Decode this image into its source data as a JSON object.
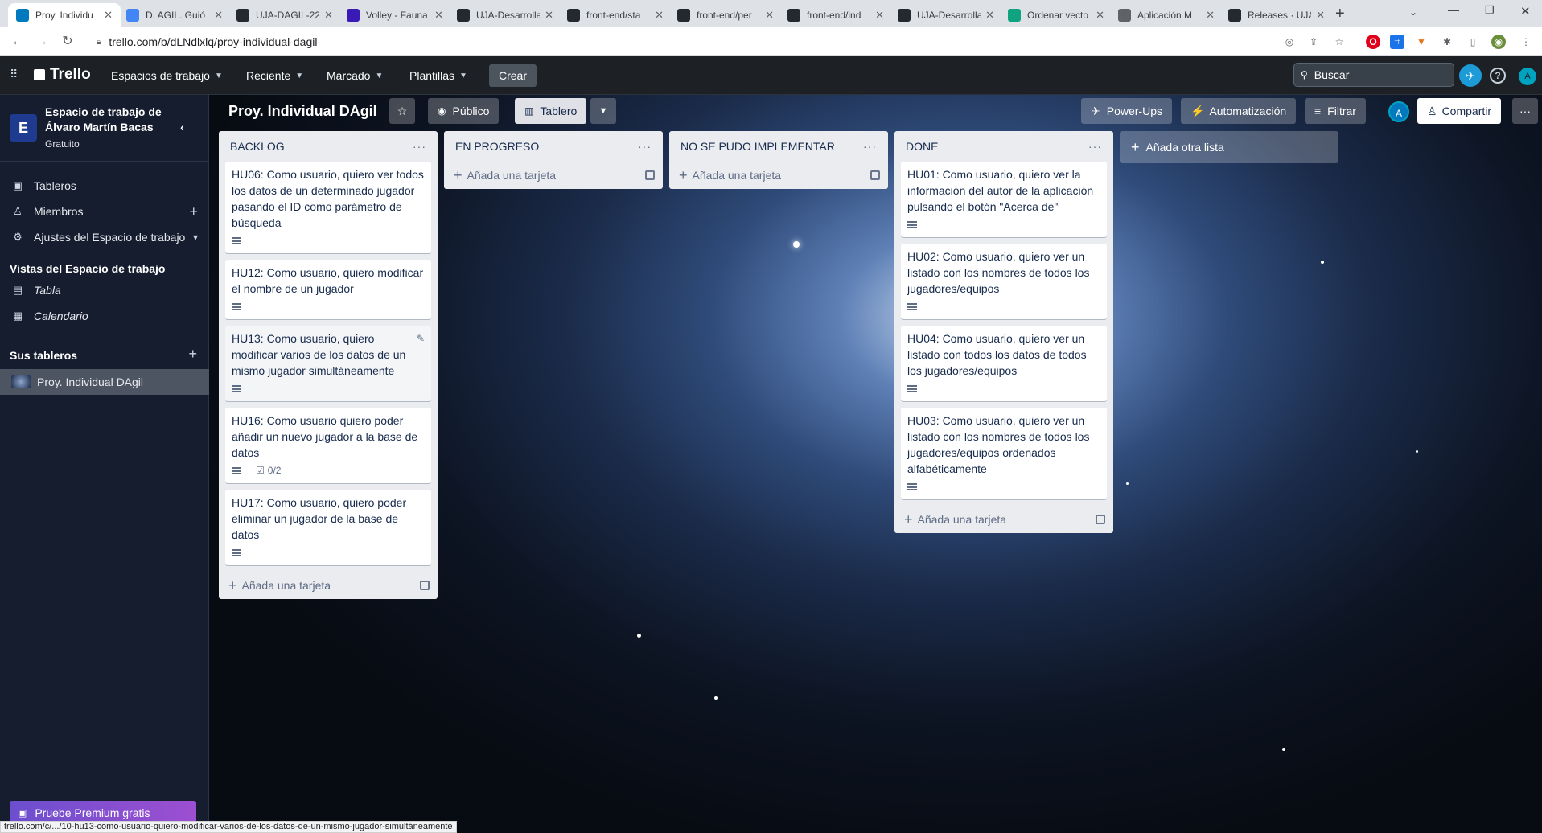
{
  "browser": {
    "tabs": [
      {
        "title": "Proy. Individu",
        "icon": "trello-icon",
        "color": "#0079bf",
        "active": true
      },
      {
        "title": "D. AGIL. Guió",
        "icon": "google-docs-icon",
        "color": "#4285f4"
      },
      {
        "title": "UJA-DAGIL-22",
        "icon": "github-icon",
        "color": "#24292f"
      },
      {
        "title": "Volley - Fauna",
        "icon": "fauna-icon",
        "color": "#3a1ab6"
      },
      {
        "title": "UJA-Desarrolla",
        "icon": "github-icon",
        "color": "#24292f"
      },
      {
        "title": "front-end/sta",
        "icon": "github-icon",
        "color": "#24292f"
      },
      {
        "title": "front-end/per",
        "icon": "github-icon",
        "color": "#24292f"
      },
      {
        "title": "front-end/ind",
        "icon": "github-icon",
        "color": "#24292f"
      },
      {
        "title": "UJA-Desarrolla",
        "icon": "github-icon",
        "color": "#24292f"
      },
      {
        "title": "Ordenar vecto",
        "icon": "chatgpt-icon",
        "color": "#10a37f"
      },
      {
        "title": "Aplicación M",
        "icon": "globe-icon",
        "color": "#5f6368"
      },
      {
        "title": "Releases · UJA",
        "icon": "github-icon",
        "color": "#24292f"
      }
    ],
    "url": "trello.com/b/dLNdlxlq/proy-individual-dagil"
  },
  "header": {
    "brand": "Trello",
    "menu": [
      "Espacios de trabajo",
      "Reciente",
      "Marcado",
      "Plantillas"
    ],
    "create": "Crear",
    "search_placeholder": "Buscar",
    "avatar": "A"
  },
  "sidebar": {
    "workspace_letter": "E",
    "workspace_name_line1": "Espacio de trabajo de",
    "workspace_name_line2": "Álvaro Martín Bacas",
    "plan": "Gratuito",
    "items": [
      "Tableros",
      "Miembros",
      "Ajustes del Espacio de trabajo"
    ],
    "views_title": "Vistas del Espacio de trabajo",
    "views": [
      "Tabla",
      "Calendario"
    ],
    "boards_title": "Sus tableros",
    "boards": [
      "Proy. Individual DAgil"
    ],
    "premium": "Pruebe Premium gratis"
  },
  "board": {
    "title": "Proy. Individual DAgil",
    "visibility": "Público",
    "view": "Tablero",
    "powerups": "Power-Ups",
    "automation": "Automatización",
    "filter": "Filtrar",
    "share": "Compartir",
    "member_avatar": "A"
  },
  "lists": [
    {
      "title": "BACKLOG",
      "cards": [
        {
          "text": "HU06: Como usuario, quiero ver todos los datos de un determinado jugador pasando el ID como parámetro de búsqueda",
          "checklist": ""
        },
        {
          "text": "HU12: Como usuario, quiero modificar el nombre de un jugador",
          "checklist": ""
        },
        {
          "text": "HU13: Como usuario, quiero modificar varios de los datos de un mismo jugador simultáneamente",
          "checklist": ""
        },
        {
          "text": "HU16: Como usuario quiero poder añadir un nuevo jugador a la base de datos",
          "checklist": "0/2"
        },
        {
          "text": "HU17: Como usuario, quiero poder eliminar un jugador de la base de datos",
          "checklist": ""
        }
      ],
      "add_card": "Añada una tarjeta"
    },
    {
      "title": "EN PROGRESO",
      "cards": [],
      "add_card": "Añada una tarjeta"
    },
    {
      "title": "NO SE PUDO IMPLEMENTAR",
      "cards": [],
      "add_card": "Añada una tarjeta"
    },
    {
      "title": "DONE",
      "cards": [
        {
          "text": "HU01: Como usuario, quiero ver la información del autor de la aplicación pulsando el botón \"Acerca de\"",
          "checklist": ""
        },
        {
          "text": "HU02: Como usuario, quiero ver un listado con los nombres de todos los jugadores/equipos",
          "checklist": ""
        },
        {
          "text": "HU04: Como usuario, quiero ver un listado con todos los datos de todos los jugadores/equipos",
          "checklist": ""
        },
        {
          "text": "HU03: Como usuario, quiero ver un listado con los nombres de todos los jugadores/equipos ordenados alfabéticamente",
          "checklist": ""
        }
      ],
      "add_card": "Añada una tarjeta"
    }
  ],
  "add_list": "Añada otra lista",
  "status_url": "trello.com/c/.../10-hu13-como-usuario-quiero-modificar-varios-de-los-datos-de-un-mismo-jugador-simultáneamente"
}
